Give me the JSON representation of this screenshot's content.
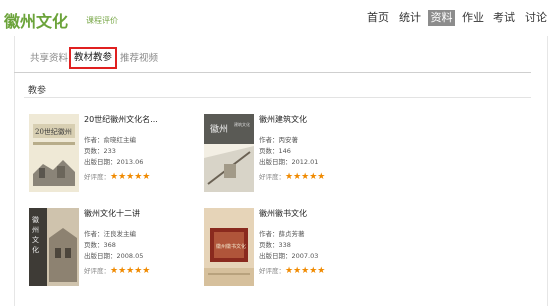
{
  "header": {
    "logo": "徽州文化",
    "logo_sub": "课程评价",
    "nav": [
      "首页",
      "统计",
      "资料",
      "作业",
      "考试",
      "讨论"
    ],
    "nav_active": "资料"
  },
  "tabs": [
    "共享资料",
    "教材教参",
    "推荐视频"
  ],
  "tab_active": "教材教参",
  "section": {
    "title": "教参"
  },
  "books": [
    {
      "title": "20世纪徽州文化名...",
      "author": "作者：俞晓红主编",
      "pages": "页数：233",
      "date": "出版日期：2013.06",
      "rating_label": "好评度：",
      "stars": "★★★★★",
      "rating": 5
    },
    {
      "title": "徽州建筑文化",
      "author": "作者：丙安著",
      "pages": "页数：146",
      "date": "出版日期：2012.01",
      "rating_label": "好评度：",
      "stars": "★★★★★",
      "rating": 5
    },
    {
      "title": "徽州文化十二讲",
      "author": "作者：汪良发主编",
      "pages": "页数：368",
      "date": "出版日期：2008.05",
      "rating_label": "好评度：",
      "stars": "★★★★★",
      "rating": 5
    },
    {
      "title": "徽州徽书文化",
      "author": "作者：薛贞芳著",
      "pages": "页数：338",
      "date": "出版日期：2007.03",
      "rating_label": "好评度：",
      "stars": "★★★★★",
      "rating": 5
    }
  ],
  "covers": [
    {
      "text": "20世纪徽州"
    },
    {
      "text": "徽州"
    },
    {
      "text": "徽州文化十二讲"
    },
    {
      "text": "徽州徽书文化"
    }
  ]
}
